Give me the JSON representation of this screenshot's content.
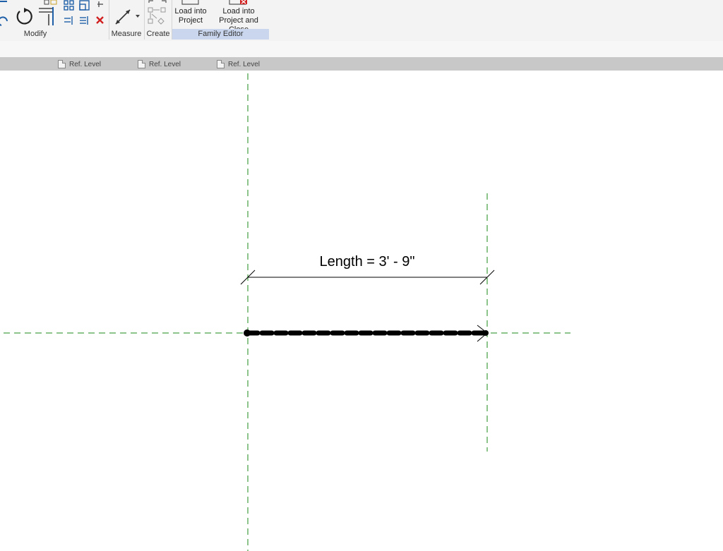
{
  "ribbon": {
    "panels": {
      "modify": "Modify",
      "measure": "Measure",
      "create": "Create",
      "family_editor": "Family Editor"
    },
    "buttons": {
      "load_into_project_line1": "Load into",
      "load_into_project_line2": "Project",
      "load_close_line1": "Load into",
      "load_close_line2": "Project and Close"
    }
  },
  "view_tabs": [
    "Ref. Level",
    "Ref. Level",
    "Ref. Level"
  ],
  "canvas": {
    "dimension_label": "Length = 3' - 9\""
  },
  "colors": {
    "ref_plane": "#1a8a1a",
    "highlight_panel": "#c9d6ee",
    "delete_icon": "#d22020"
  }
}
